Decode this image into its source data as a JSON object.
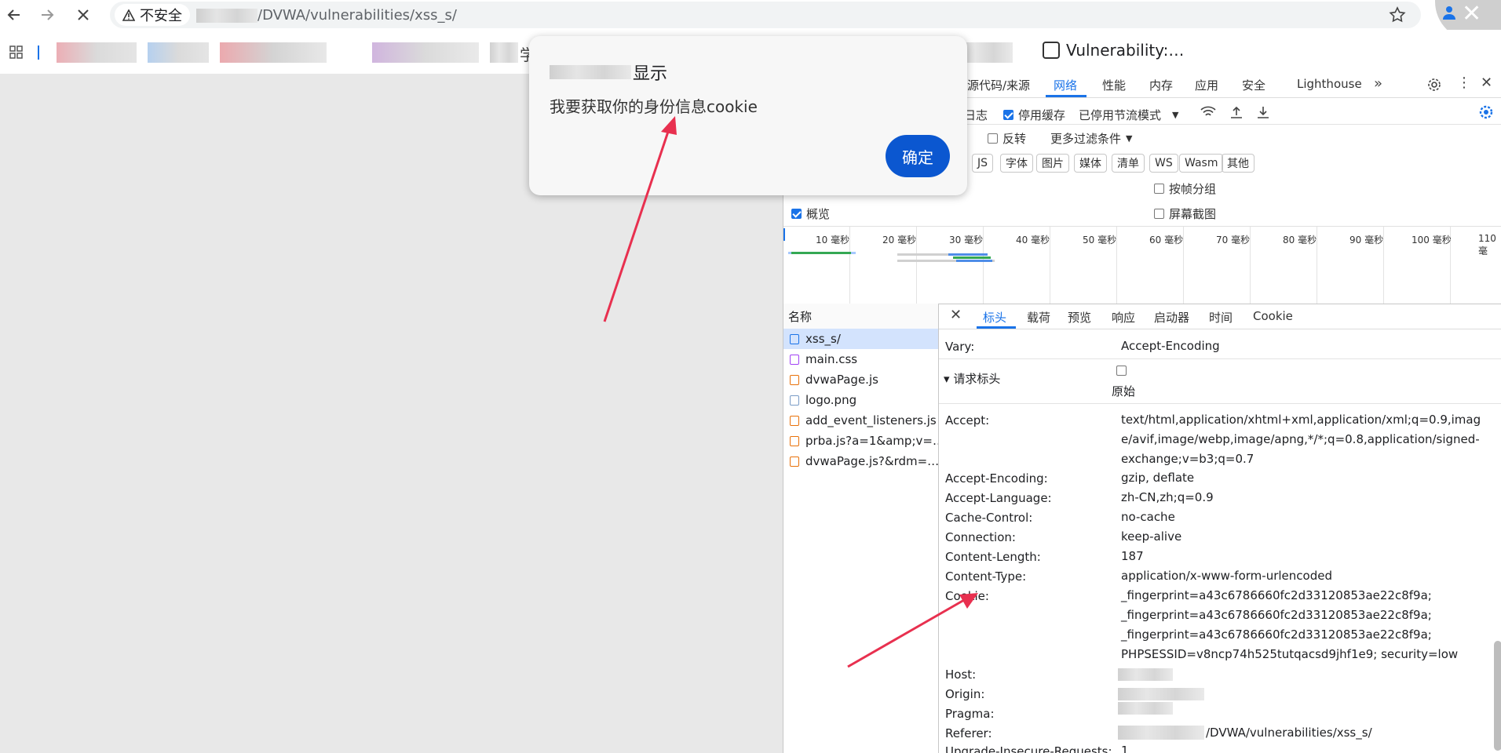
{
  "browser": {
    "security_label": "不安全",
    "url_path": "/DVWA/vulnerabilities/xss_s/",
    "tab_title": "Vulnerability:…",
    "bookmark_char": "学"
  },
  "dialog": {
    "title_suffix": "显示",
    "message": "我要获取你的身份信息cookie",
    "ok_label": "确定"
  },
  "devtools": {
    "tabs": [
      "源代码/来源",
      "网络",
      "性能",
      "内存",
      "应用",
      "安全",
      "Lighthouse"
    ],
    "active_tab": "网络",
    "toolbar": {
      "preserve_log_fragment": "日志",
      "disable_cache": "停用缓存",
      "throttle": "已停用节流模式"
    },
    "filter": {
      "invert": "反转",
      "more_filters": "更多过滤条件"
    },
    "type_filters": [
      "JS",
      "字体",
      "图片",
      "媒体",
      "清单",
      "WS",
      "Wasm",
      "其他"
    ],
    "options": {
      "group_by_frame": "按帧分组",
      "overview": "概览",
      "screenshots": "屏幕截图"
    },
    "timeline_ticks": [
      "10 毫秒",
      "20 毫秒",
      "30 毫秒",
      "40 毫秒",
      "50 毫秒",
      "60 毫秒",
      "70 毫秒",
      "80 毫秒",
      "90 毫秒",
      "100 毫秒",
      "110 毫"
    ],
    "request_list": {
      "column_name": "名称",
      "items": [
        {
          "name": "xss_s/",
          "kind": "doc"
        },
        {
          "name": "main.css",
          "kind": "css"
        },
        {
          "name": "dvwaPage.js",
          "kind": "js"
        },
        {
          "name": "logo.png",
          "kind": "img"
        },
        {
          "name": "add_event_listeners.js",
          "kind": "js"
        },
        {
          "name": "prba.js?a=1&amp;v=…",
          "kind": "js"
        },
        {
          "name": "dvwaPage.js?&rdm=…",
          "kind": "js"
        }
      ]
    },
    "detail_tabs": [
      "标头",
      "载荷",
      "预览",
      "响应",
      "启动器",
      "时间",
      "Cookie"
    ],
    "active_detail_tab": "标头",
    "response_header": {
      "key": "Vary:",
      "value": "Accept-Encoding"
    },
    "request_headers_section": {
      "title": "请求标头",
      "raw_label": "原始"
    },
    "request_headers": [
      {
        "key": "Accept:",
        "value": "text/html,application/xhtml+xml,application/xml;q=0.9,image/avif,image/webp,image/apng,*/*;q=0.8,application/signed-exchange;v=b3;q=0.7"
      },
      {
        "key": "Accept-Encoding:",
        "value": "gzip, deflate"
      },
      {
        "key": "Accept-Language:",
        "value": "zh-CN,zh;q=0.9"
      },
      {
        "key": "Cache-Control:",
        "value": "no-cache"
      },
      {
        "key": "Connection:",
        "value": "keep-alive"
      },
      {
        "key": "Content-Length:",
        "value": "187"
      },
      {
        "key": "Content-Type:",
        "value": "application/x-www-form-urlencoded"
      },
      {
        "key": "Cookie:",
        "value_lines": [
          "_fingerprint=a43c6786660fc2d33120853ae22c8f9a;",
          "_fingerprint=a43c6786660fc2d33120853ae22c8f9a;",
          "_fingerprint=a43c6786660fc2d33120853ae22c8f9a;",
          "PHPSESSID=v8ncp74h525tutqacsd9jhf1e9; security=low"
        ]
      },
      {
        "key": "Host:",
        "value": ""
      },
      {
        "key": "Origin:",
        "value": ""
      },
      {
        "key": "Pragma:",
        "value": ""
      },
      {
        "key": "Referer:",
        "value": "/DVWA/vulnerabilities/xss_s/"
      },
      {
        "key": "Upgrade-Insecure-Requests:",
        "value": "1"
      }
    ]
  },
  "colors": {
    "accent": "#1a73e8",
    "dialog_button": "#0b57d0",
    "arrow": "#e8304f",
    "selection": "#d3e3fd"
  }
}
